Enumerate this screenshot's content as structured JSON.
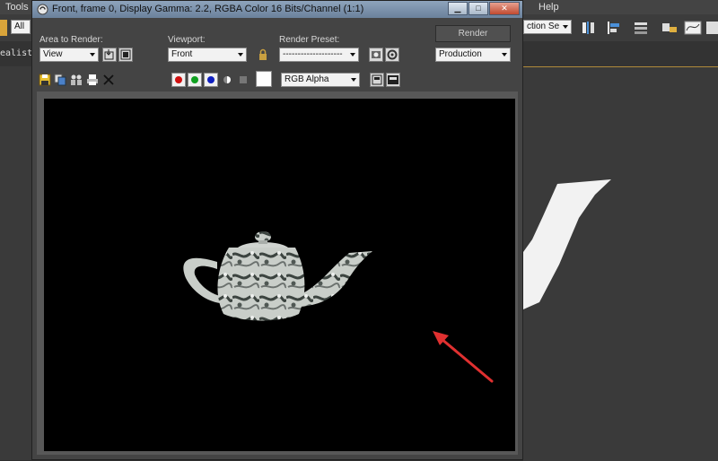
{
  "background_app": {
    "menu": {
      "tools": "Tools",
      "help": "Help"
    },
    "toolbar": {
      "selection_filter": "All",
      "named_selection": "ction Se"
    },
    "viewport_label": "ealisti"
  },
  "frame_window": {
    "title": "Front, frame 0, Display Gamma: 2.2, RGBA Color 16 Bits/Channel (1:1)",
    "controls": {
      "area_to_render_label": "Area to Render:",
      "area_to_render_value": "View",
      "viewport_label": "Viewport:",
      "viewport_value": "Front",
      "render_preset_label": "Render Preset:",
      "render_preset_value": "--------------------",
      "render_button": "Render",
      "render_mode_value": "Production",
      "channel_display_value": "RGB Alpha"
    },
    "channel_colors": {
      "red": "#d01010",
      "green": "#10a020",
      "blue": "#1020c0"
    }
  },
  "accent": {
    "arrow": "#e03030"
  }
}
